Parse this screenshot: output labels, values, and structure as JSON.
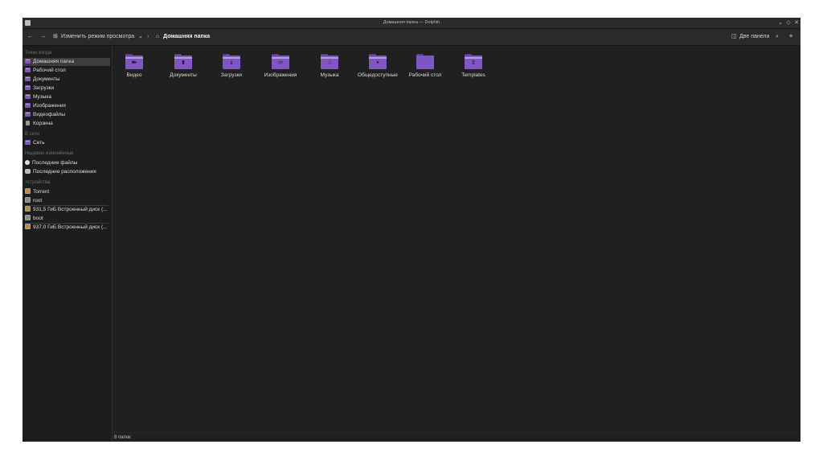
{
  "window": {
    "title": "Домашняя папка — Dolphin",
    "controls": {
      "minimize": "⌄",
      "maximize": "◇",
      "close": "✕"
    }
  },
  "toolbar": {
    "back_icon": "←",
    "forward_icon": "→",
    "view_mode_icon": "⊞",
    "view_mode_label": "Изменить режим просмотра",
    "view_mode_dropdown": "⌄",
    "breadcrumb_sep": "›",
    "home_icon": "⌂",
    "current_folder": "Домашняя папка",
    "split_icon": "◫",
    "split_label": "Две панели",
    "search_icon": "⌕",
    "menu_icon": "≡"
  },
  "sidebar": {
    "sections": {
      "places": "Точки входа",
      "network": "В сети",
      "recent": "Недавно изменённые",
      "devices": "Устройства"
    },
    "places": [
      {
        "label": "Домашняя папка",
        "icon": "home-folder-icon"
      },
      {
        "label": "Рабочий стол",
        "icon": "desktop-folder-icon"
      },
      {
        "label": "Документы",
        "icon": "documents-folder-icon"
      },
      {
        "label": "Загрузки",
        "icon": "downloads-folder-icon"
      },
      {
        "label": "Музыка",
        "icon": "music-folder-icon"
      },
      {
        "label": "Изображения",
        "icon": "pictures-folder-icon"
      },
      {
        "label": "Видеофайлы",
        "icon": "videos-folder-icon"
      },
      {
        "label": "Корзина",
        "icon": "trash-icon"
      }
    ],
    "network": [
      {
        "label": "Сеть",
        "icon": "network-folder-icon"
      }
    ],
    "recent": [
      {
        "label": "Последние файлы",
        "icon": "clock-icon"
      },
      {
        "label": "Последние расположения",
        "icon": "locations-icon"
      }
    ],
    "devices": [
      {
        "label": "Torrent",
        "icon": "drive-icon"
      },
      {
        "label": "root",
        "icon": "drive-icon"
      },
      {
        "label": "931,5 ГиБ Встроенный диск (...",
        "icon": "drive-icon"
      },
      {
        "label": "boot",
        "icon": "drive-icon"
      },
      {
        "label": "937,0 ГиБ Встроенный диск (...",
        "icon": "drive-icon"
      }
    ]
  },
  "folders": [
    {
      "label": "Видео",
      "emblem": "■▸",
      "icon": "video-folder-icon"
    },
    {
      "label": "Документы",
      "emblem": "▮",
      "icon": "documents-folder-icon"
    },
    {
      "label": "Загрузки",
      "emblem": "⤓",
      "icon": "downloads-folder-icon"
    },
    {
      "label": "Изображения",
      "emblem": "▭",
      "icon": "pictures-folder-icon"
    },
    {
      "label": "Музыка",
      "emblem": "♫",
      "icon": "music-folder-icon"
    },
    {
      "label": "Общедоступные",
      "emblem": "●",
      "icon": "public-folder-icon"
    },
    {
      "label": "Рабочий стол",
      "emblem": "",
      "icon": "desktop-folder-icon"
    },
    {
      "label": "Templates",
      "emblem": "▯",
      "icon": "templates-folder-icon"
    }
  ],
  "status": {
    "text": "8 папок"
  },
  "colors": {
    "accent": "#7e57c2",
    "background": "#202020",
    "sidebar": "#1d1d1d"
  }
}
